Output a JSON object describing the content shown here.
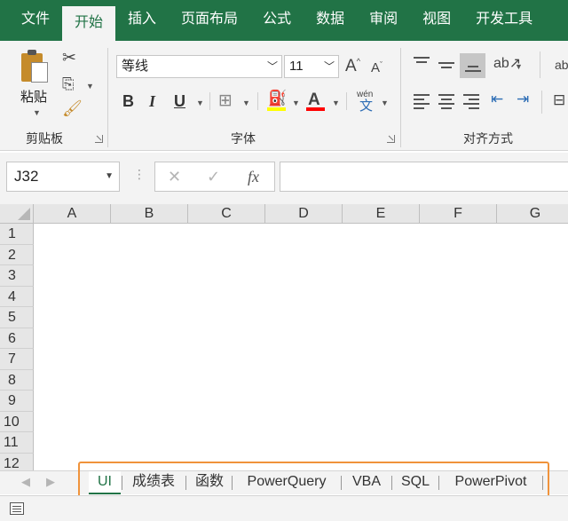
{
  "menu_tabs": [
    "文件",
    "开始",
    "插入",
    "页面布局",
    "公式",
    "数据",
    "审阅",
    "视图",
    "开发工具"
  ],
  "active_menu_tab": "开始",
  "ribbon": {
    "clipboard": {
      "paste_label": "粘贴",
      "group_label": "剪贴板"
    },
    "font": {
      "font_name": "等线",
      "font_size": "11",
      "group_label": "字体",
      "bold": "B",
      "italic": "I",
      "underline": "U",
      "grow": "A",
      "shrink": "A",
      "wen_top": "wén",
      "wen_char": "文"
    },
    "alignment": {
      "group_label": "对齐方式"
    },
    "cut_off": "ab"
  },
  "formula_bar": {
    "name_box": "J32",
    "cancel": "✕",
    "enter": "✓",
    "fx": "fx",
    "value": ""
  },
  "columns": [
    "A",
    "B",
    "C",
    "D",
    "E",
    "F",
    "G"
  ],
  "rows": [
    "1",
    "2",
    "3",
    "4",
    "5",
    "6",
    "7",
    "8",
    "9",
    "10",
    "11",
    "12"
  ],
  "sheet_tabs": [
    "UI",
    "成绩表",
    "函数",
    "PowerQuery",
    "VBA",
    "SQL",
    "PowerPivot"
  ],
  "active_sheet": "UI",
  "colors": {
    "accent": "#217346",
    "highlight_box": "#f0933b",
    "fill_color": "#ffff00",
    "font_color": "#ff0000"
  },
  "icons": [
    "cut-icon",
    "copy-icon",
    "format-painter-icon",
    "border-icon",
    "fill-color-icon",
    "font-color-icon",
    "phonetic-icon",
    "align-icon",
    "orientation-icon",
    "indent-icon"
  ]
}
